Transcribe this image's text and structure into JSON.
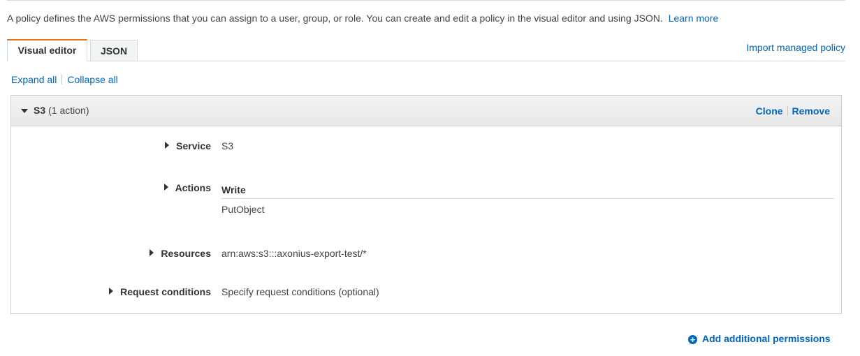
{
  "intro": {
    "text": "A policy defines the AWS permissions that you can assign to a user, group, or role. You can create and edit a policy in the visual editor and using JSON.",
    "learn_more": "Learn more"
  },
  "tabs": [
    {
      "label": "Visual editor",
      "active": true
    },
    {
      "label": "JSON",
      "active": false
    }
  ],
  "import_link": "Import managed policy",
  "expand_all": "Expand all",
  "collapse_all": "Collapse all",
  "statement": {
    "service_short": "S3",
    "action_count": "(1 action)",
    "clone": "Clone",
    "remove": "Remove",
    "service_label": "Service",
    "service_value": "S3",
    "actions_label": "Actions",
    "actions_group": "Write",
    "actions_item": "PutObject",
    "resources_label": "Resources",
    "resources_value": "arn:aws:s3:::axonius-export-test/*",
    "conditions_label": "Request conditions",
    "conditions_link": "Specify request conditions (optional)"
  },
  "add_permissions": "Add additional permissions",
  "colors": {
    "link": "#0066c0",
    "active_tab_accent": "#ec7211",
    "border": "#c9cccc"
  }
}
